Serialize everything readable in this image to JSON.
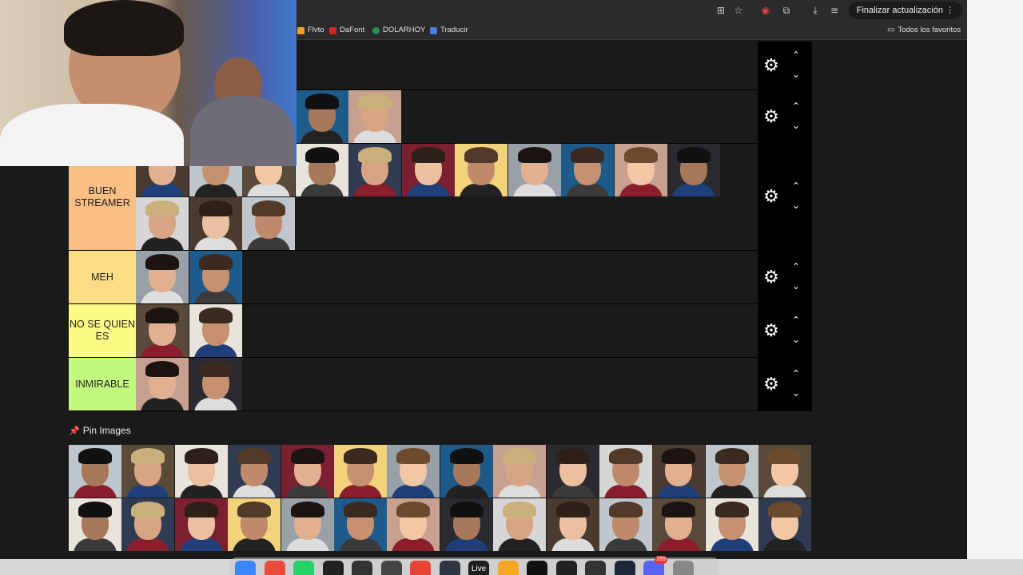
{
  "toolbar": {
    "update_label": "Finalizar actualización"
  },
  "bookmarks": {
    "items": [
      {
        "label": "Flvto",
        "icon": "flvto-icon"
      },
      {
        "label": "DaFont",
        "icon": "dafont-icon"
      },
      {
        "label": "DOLARHOY",
        "icon": "dolarhoy-icon"
      },
      {
        "label": "Traducir",
        "icon": "translate-icon"
      }
    ],
    "favorites_label": "Todos los favoritos"
  },
  "tiers": [
    {
      "label": "",
      "color": "#1a1a1a",
      "count": 0
    },
    {
      "label": "",
      "color": "#1a1a1a",
      "count": 5
    },
    {
      "label": "BUEN STREAMER",
      "color": "#f9bf84",
      "count": 14
    },
    {
      "label": "MEH",
      "color": "#fbdd85",
      "count": 2
    },
    {
      "label": "NO SE QUIEN ES",
      "color": "#fcfb86",
      "count": 2
    },
    {
      "label": "INMIRABLE",
      "color": "#c3f97e",
      "count": 2
    }
  ],
  "pin_images": {
    "title": "Pin Images",
    "icon": "pin-icon",
    "count": 28
  },
  "dock": {
    "live_label": "Live",
    "discord_badge": "269"
  },
  "colors": {
    "background": "#1a1a1a",
    "control": "#000000"
  }
}
